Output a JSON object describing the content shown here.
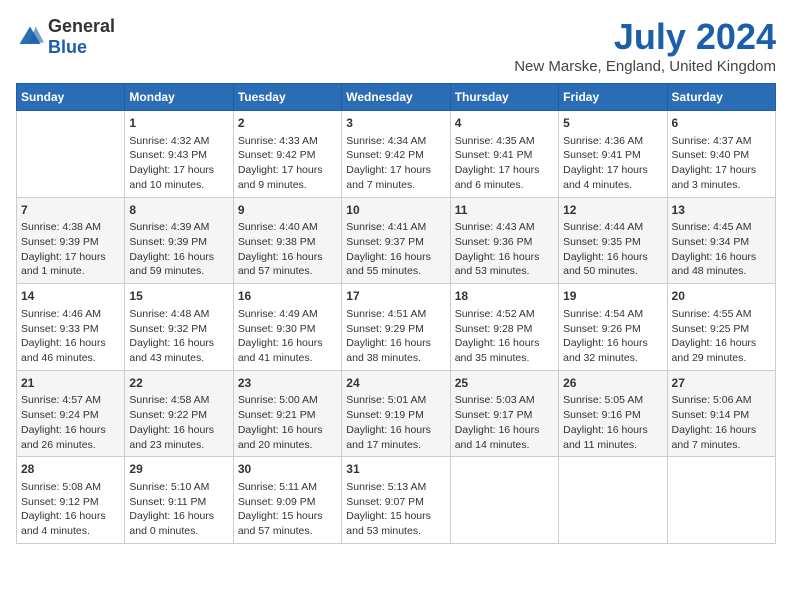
{
  "logo": {
    "general": "General",
    "blue": "Blue"
  },
  "title": "July 2024",
  "subtitle": "New Marske, England, United Kingdom",
  "header_days": [
    "Sunday",
    "Monday",
    "Tuesday",
    "Wednesday",
    "Thursday",
    "Friday",
    "Saturday"
  ],
  "weeks": [
    [
      {
        "day": "",
        "sunrise": "",
        "sunset": "",
        "daylight": ""
      },
      {
        "day": "1",
        "sunrise": "Sunrise: 4:32 AM",
        "sunset": "Sunset: 9:43 PM",
        "daylight": "Daylight: 17 hours and 10 minutes."
      },
      {
        "day": "2",
        "sunrise": "Sunrise: 4:33 AM",
        "sunset": "Sunset: 9:42 PM",
        "daylight": "Daylight: 17 hours and 9 minutes."
      },
      {
        "day": "3",
        "sunrise": "Sunrise: 4:34 AM",
        "sunset": "Sunset: 9:42 PM",
        "daylight": "Daylight: 17 hours and 7 minutes."
      },
      {
        "day": "4",
        "sunrise": "Sunrise: 4:35 AM",
        "sunset": "Sunset: 9:41 PM",
        "daylight": "Daylight: 17 hours and 6 minutes."
      },
      {
        "day": "5",
        "sunrise": "Sunrise: 4:36 AM",
        "sunset": "Sunset: 9:41 PM",
        "daylight": "Daylight: 17 hours and 4 minutes."
      },
      {
        "day": "6",
        "sunrise": "Sunrise: 4:37 AM",
        "sunset": "Sunset: 9:40 PM",
        "daylight": "Daylight: 17 hours and 3 minutes."
      }
    ],
    [
      {
        "day": "7",
        "sunrise": "Sunrise: 4:38 AM",
        "sunset": "Sunset: 9:39 PM",
        "daylight": "Daylight: 17 hours and 1 minute."
      },
      {
        "day": "8",
        "sunrise": "Sunrise: 4:39 AM",
        "sunset": "Sunset: 9:39 PM",
        "daylight": "Daylight: 16 hours and 59 minutes."
      },
      {
        "day": "9",
        "sunrise": "Sunrise: 4:40 AM",
        "sunset": "Sunset: 9:38 PM",
        "daylight": "Daylight: 16 hours and 57 minutes."
      },
      {
        "day": "10",
        "sunrise": "Sunrise: 4:41 AM",
        "sunset": "Sunset: 9:37 PM",
        "daylight": "Daylight: 16 hours and 55 minutes."
      },
      {
        "day": "11",
        "sunrise": "Sunrise: 4:43 AM",
        "sunset": "Sunset: 9:36 PM",
        "daylight": "Daylight: 16 hours and 53 minutes."
      },
      {
        "day": "12",
        "sunrise": "Sunrise: 4:44 AM",
        "sunset": "Sunset: 9:35 PM",
        "daylight": "Daylight: 16 hours and 50 minutes."
      },
      {
        "day": "13",
        "sunrise": "Sunrise: 4:45 AM",
        "sunset": "Sunset: 9:34 PM",
        "daylight": "Daylight: 16 hours and 48 minutes."
      }
    ],
    [
      {
        "day": "14",
        "sunrise": "Sunrise: 4:46 AM",
        "sunset": "Sunset: 9:33 PM",
        "daylight": "Daylight: 16 hours and 46 minutes."
      },
      {
        "day": "15",
        "sunrise": "Sunrise: 4:48 AM",
        "sunset": "Sunset: 9:32 PM",
        "daylight": "Daylight: 16 hours and 43 minutes."
      },
      {
        "day": "16",
        "sunrise": "Sunrise: 4:49 AM",
        "sunset": "Sunset: 9:30 PM",
        "daylight": "Daylight: 16 hours and 41 minutes."
      },
      {
        "day": "17",
        "sunrise": "Sunrise: 4:51 AM",
        "sunset": "Sunset: 9:29 PM",
        "daylight": "Daylight: 16 hours and 38 minutes."
      },
      {
        "day": "18",
        "sunrise": "Sunrise: 4:52 AM",
        "sunset": "Sunset: 9:28 PM",
        "daylight": "Daylight: 16 hours and 35 minutes."
      },
      {
        "day": "19",
        "sunrise": "Sunrise: 4:54 AM",
        "sunset": "Sunset: 9:26 PM",
        "daylight": "Daylight: 16 hours and 32 minutes."
      },
      {
        "day": "20",
        "sunrise": "Sunrise: 4:55 AM",
        "sunset": "Sunset: 9:25 PM",
        "daylight": "Daylight: 16 hours and 29 minutes."
      }
    ],
    [
      {
        "day": "21",
        "sunrise": "Sunrise: 4:57 AM",
        "sunset": "Sunset: 9:24 PM",
        "daylight": "Daylight: 16 hours and 26 minutes."
      },
      {
        "day": "22",
        "sunrise": "Sunrise: 4:58 AM",
        "sunset": "Sunset: 9:22 PM",
        "daylight": "Daylight: 16 hours and 23 minutes."
      },
      {
        "day": "23",
        "sunrise": "Sunrise: 5:00 AM",
        "sunset": "Sunset: 9:21 PM",
        "daylight": "Daylight: 16 hours and 20 minutes."
      },
      {
        "day": "24",
        "sunrise": "Sunrise: 5:01 AM",
        "sunset": "Sunset: 9:19 PM",
        "daylight": "Daylight: 16 hours and 17 minutes."
      },
      {
        "day": "25",
        "sunrise": "Sunrise: 5:03 AM",
        "sunset": "Sunset: 9:17 PM",
        "daylight": "Daylight: 16 hours and 14 minutes."
      },
      {
        "day": "26",
        "sunrise": "Sunrise: 5:05 AM",
        "sunset": "Sunset: 9:16 PM",
        "daylight": "Daylight: 16 hours and 11 minutes."
      },
      {
        "day": "27",
        "sunrise": "Sunrise: 5:06 AM",
        "sunset": "Sunset: 9:14 PM",
        "daylight": "Daylight: 16 hours and 7 minutes."
      }
    ],
    [
      {
        "day": "28",
        "sunrise": "Sunrise: 5:08 AM",
        "sunset": "Sunset: 9:12 PM",
        "daylight": "Daylight: 16 hours and 4 minutes."
      },
      {
        "day": "29",
        "sunrise": "Sunrise: 5:10 AM",
        "sunset": "Sunset: 9:11 PM",
        "daylight": "Daylight: 16 hours and 0 minutes."
      },
      {
        "day": "30",
        "sunrise": "Sunrise: 5:11 AM",
        "sunset": "Sunset: 9:09 PM",
        "daylight": "Daylight: 15 hours and 57 minutes."
      },
      {
        "day": "31",
        "sunrise": "Sunrise: 5:13 AM",
        "sunset": "Sunset: 9:07 PM",
        "daylight": "Daylight: 15 hours and 53 minutes."
      },
      {
        "day": "",
        "sunrise": "",
        "sunset": "",
        "daylight": ""
      },
      {
        "day": "",
        "sunrise": "",
        "sunset": "",
        "daylight": ""
      },
      {
        "day": "",
        "sunrise": "",
        "sunset": "",
        "daylight": ""
      }
    ]
  ]
}
